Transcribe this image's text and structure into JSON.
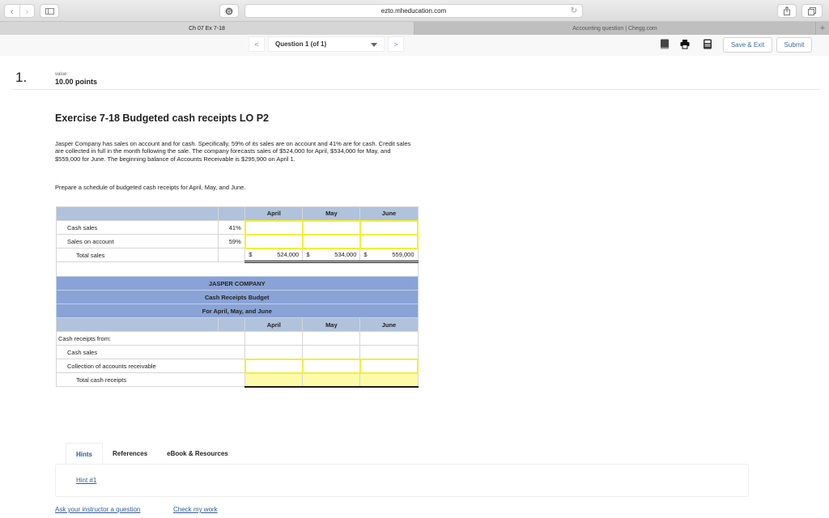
{
  "browser": {
    "url": "ezto.mheducation.com",
    "tabs": [
      {
        "label": "Ch 07 Ex 7-18",
        "active": true
      },
      {
        "label": "Accounting question | Chegg.com",
        "active": false
      }
    ],
    "new_tab_symbol": "+",
    "back_symbol": "‹",
    "forward_symbol": "›",
    "reload_symbol": "↻"
  },
  "header": {
    "question_selector": "Question 1 (of 1)",
    "prev_symbol": "<",
    "next_symbol": ">",
    "icons": [
      "book-icon",
      "printer-icon",
      "calculator-icon"
    ],
    "save_exit_label": "Save & Exit",
    "submit_label": "Submit"
  },
  "question": {
    "number": "1.",
    "value_label": "value:",
    "points": "10.00 points",
    "title": "Exercise 7-18 Budgeted cash receipts LO P2",
    "body": "Jasper Company has sales on account and for cash. Specifically, 59% of its sales are on account and 41% are for cash. Credit sales are collected in full in the month following the sale. The company forecasts sales of $524,000 for April, $534,000 for May, and $559,000 for June. The beginning balance of Accounts Receivable is $295,900 on April 1.",
    "prompt": "Prepare a schedule of budgeted cash receipts for April, May, and June."
  },
  "sales_table": {
    "columns": [
      "April",
      "May",
      "June"
    ],
    "rows": [
      {
        "label": "Cash sales",
        "pct": "41%",
        "values": [
          "",
          "",
          ""
        ]
      },
      {
        "label": "Sales on account",
        "pct": "59%",
        "values": [
          "",
          "",
          ""
        ]
      }
    ],
    "total": {
      "label": "Total sales",
      "currency": "$",
      "values": [
        "524,000",
        "534,000",
        "559,000"
      ]
    }
  },
  "budget_table": {
    "company": "JASPER COMPANY",
    "title": "Cash Receipts Budget",
    "period": "For April, May, and June",
    "columns": [
      "April",
      "May",
      "June"
    ],
    "section_label": "Cash receipts from:",
    "rows": [
      {
        "label": "Cash sales",
        "values": [
          "",
          "",
          ""
        ]
      },
      {
        "label": "Collection of accounts receivable",
        "values": [
          "",
          "",
          ""
        ]
      }
    ],
    "total_label": "Total cash receipts",
    "total_values": [
      "",
      "",
      ""
    ]
  },
  "resources": {
    "tabs": [
      "Hints",
      "References",
      "eBook & Resources"
    ],
    "active_tab": "Hints",
    "hint_link": "Hint #1"
  },
  "footer_links": {
    "ask": "Ask your instructor a question",
    "check": "Check my work"
  }
}
